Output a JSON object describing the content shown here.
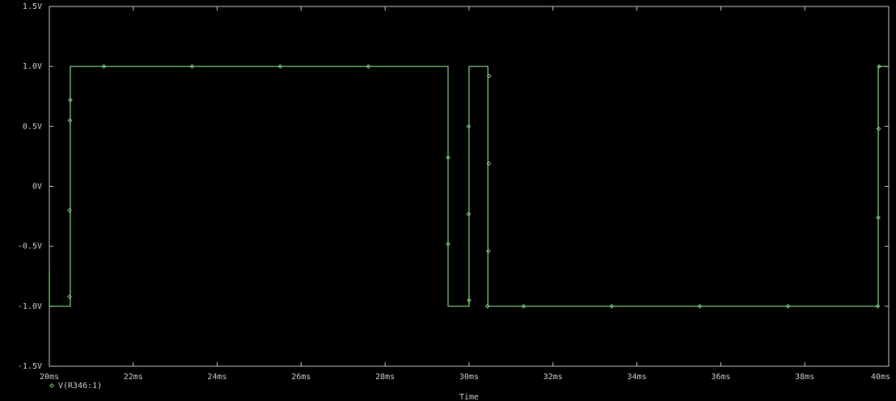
{
  "chart_data": {
    "type": "line",
    "title": "",
    "xlabel": "Time",
    "ylabel": "",
    "xlim": [
      20,
      40
    ],
    "ylim": [
      -1.5,
      1.5
    ],
    "x_unit": "ms",
    "grid": false,
    "legend_position": "bottom-left",
    "x_ticks": [
      {
        "value": 20,
        "label": "20ms"
      },
      {
        "value": 22,
        "label": "22ms"
      },
      {
        "value": 24,
        "label": "24ms"
      },
      {
        "value": 26,
        "label": "26ms"
      },
      {
        "value": 28,
        "label": "28ms"
      },
      {
        "value": 30,
        "label": "30ms"
      },
      {
        "value": 32,
        "label": "32ms"
      },
      {
        "value": 34,
        "label": "34ms"
      },
      {
        "value": 36,
        "label": "36ms"
      },
      {
        "value": 38,
        "label": "38ms"
      },
      {
        "value": 40,
        "label": "40ms"
      }
    ],
    "y_ticks": [
      {
        "value": 1.5,
        "label": "1.5V"
      },
      {
        "value": 1.0,
        "label": "1.0V"
      },
      {
        "value": 0.5,
        "label": "0.5V"
      },
      {
        "value": 0.0,
        "label": "0V"
      },
      {
        "value": -0.5,
        "label": "-0.5V"
      },
      {
        "value": -1.0,
        "label": "-1.0V"
      },
      {
        "value": -1.5,
        "label": "-1.5V"
      }
    ],
    "series": [
      {
        "name": "V(R346:1)",
        "color": "#7fd17f",
        "marker": "diamond",
        "x": [
          20.0,
          20.0,
          20.0,
          20.5,
          20.5,
          29.5,
          29.5,
          30.0,
          30.0,
          30.45,
          30.45,
          39.75,
          39.75,
          40.0
        ],
        "y": [
          -0.7,
          -1.0,
          -1.0,
          -1.0,
          1.0,
          1.0,
          -1.0,
          -1.0,
          1.0,
          1.0,
          -1.0,
          -1.0,
          1.0,
          1.0
        ],
        "markers_x": [
          20.48,
          20.48,
          20.49,
          20.5,
          21.3,
          23.4,
          25.5,
          27.6,
          29.5,
          29.5,
          29.99,
          29.99,
          30.0,
          30.48,
          30.47,
          30.46,
          30.44,
          31.3,
          33.4,
          35.5,
          37.6,
          39.74,
          39.75,
          39.76,
          39.77
        ],
        "markers_y": [
          -0.92,
          -0.2,
          0.55,
          0.72,
          1.0,
          1.0,
          1.0,
          1.0,
          0.24,
          -0.48,
          0.5,
          -0.23,
          -0.95,
          0.92,
          0.19,
          -0.54,
          -1.0,
          -1.0,
          -1.0,
          -1.0,
          -1.0,
          -1.0,
          -0.26,
          0.48,
          1.0
        ]
      }
    ]
  }
}
